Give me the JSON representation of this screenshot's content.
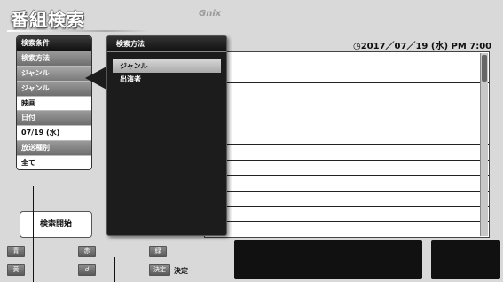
{
  "header": {
    "title": "番組検索",
    "logo": "Gnix",
    "datetime": "◷2017／07／19 (水) PM 7:00"
  },
  "conditions": {
    "items": [
      {
        "label": "検索条件",
        "style": "head"
      },
      {
        "label": "検索方法",
        "style": "sub"
      },
      {
        "label": "ジャンル",
        "style": "sel"
      },
      {
        "label": "ジャンル",
        "style": "sub"
      },
      {
        "label": "映画",
        "style": "val"
      },
      {
        "label": "日付",
        "style": "sub"
      },
      {
        "label": "07/19 (水)",
        "style": "val"
      },
      {
        "label": "放送種別",
        "style": "sub"
      },
      {
        "label": "全て",
        "style": "val"
      }
    ],
    "search_button": "検索開始"
  },
  "popup": {
    "title": "検索方法",
    "options": [
      "ジャンル",
      "出演者"
    ],
    "selected": "ジャンル"
  },
  "keys": {
    "blue": "青",
    "red": "赤",
    "green": "緑",
    "yellow": "黄",
    "d": "d",
    "enter": "決定",
    "enter_label": "決定"
  }
}
